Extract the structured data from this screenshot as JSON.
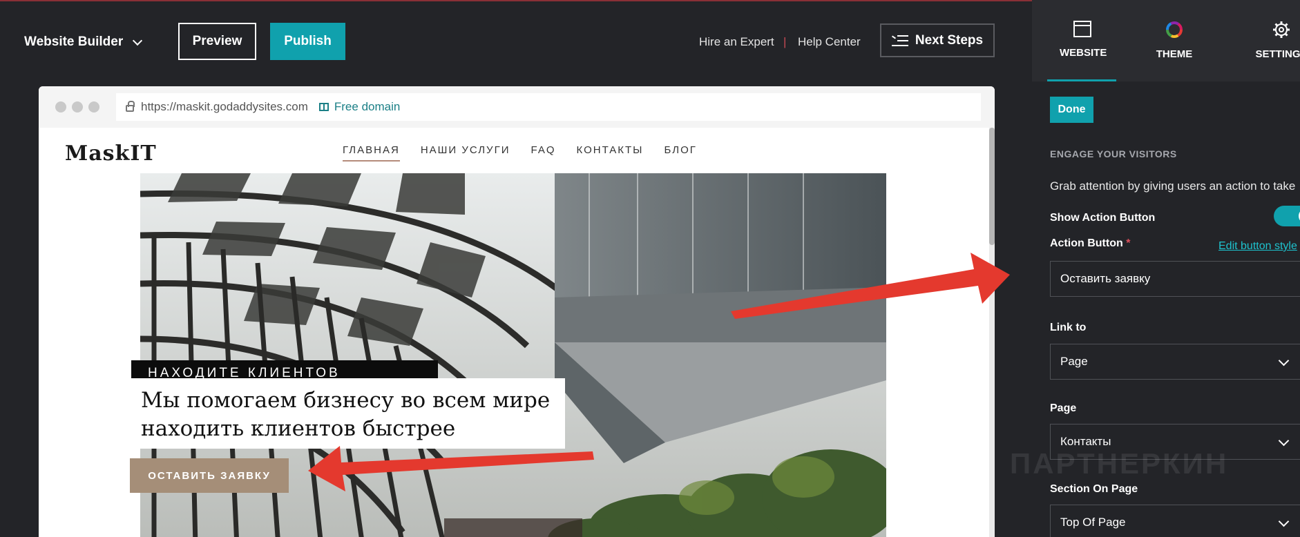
{
  "topbar": {
    "brand": "Website Builder",
    "preview_label": "Preview",
    "publish_label": "Publish",
    "hire_label": "Hire an Expert",
    "separator": "|",
    "help_label": "Help Center",
    "next_steps_label": "Next Steps"
  },
  "browser": {
    "url": "https://maskit.godaddysites.com",
    "free_domain_label": "Free domain"
  },
  "site": {
    "logo": "MaskIT",
    "nav": [
      "ГЛАВНАЯ",
      "НАШИ УСЛУГИ",
      "FAQ",
      "КОНТАКТЫ",
      "БЛОГ"
    ],
    "eyebrow": "НАХОДИТЕ КЛИЕНТОВ БЫСТРЕЕ",
    "headline_line1": "Мы помогаем бизнесу во всем мире",
    "headline_line2": "находить клиентов быстрее",
    "cta_label": "ОСТАВИТЬ ЗАЯВКУ"
  },
  "panel": {
    "tabs": [
      "WEBSITE",
      "THEME",
      "SETTINGS"
    ],
    "done_label": "Done",
    "section_heading": "ENGAGE YOUR VISITORS",
    "section_text": "Grab attention by giving users an action to take",
    "show_action_label": "Show Action Button",
    "action_button_label": "Action Button",
    "required_mark": "*",
    "edit_style_label": "Edit button style",
    "action_button_value": "Оставить заявку",
    "link_to_label": "Link to",
    "link_to_value": "Page",
    "page_label": "Page",
    "page_value": "Контакты",
    "section_on_page_label": "Section On Page",
    "section_on_page_value": "Top Of Page"
  },
  "watermark": "ПАРТНЕРКИН",
  "colors": {
    "accent": "#10a1ad",
    "editor_bg": "#232428",
    "cta": "#a58e78",
    "arrow": "#e4392e"
  }
}
